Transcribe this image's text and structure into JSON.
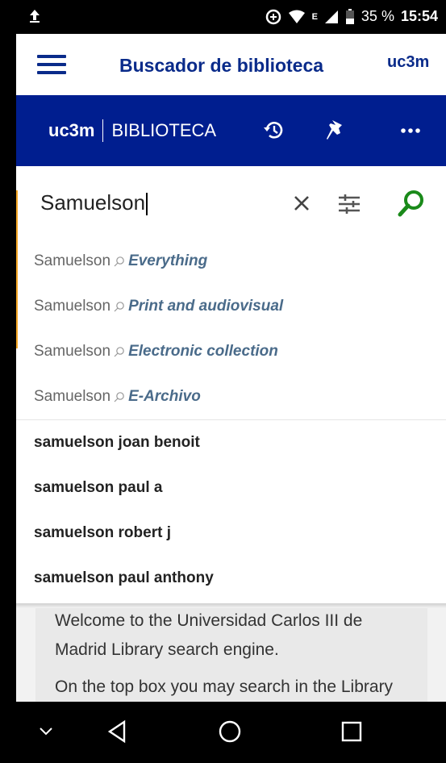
{
  "status": {
    "battery": "35 %",
    "time": "15:54",
    "network": "E"
  },
  "header": {
    "title": "Buscador de biblioteca",
    "logo": "uc3m",
    "menu_icon": "menu-icon"
  },
  "libbar": {
    "brand_uc3m": "uc3m",
    "brand_biblioteca": "BIBLIOTECA",
    "icons": [
      "history-icon",
      "pin-icon",
      "more-icon"
    ]
  },
  "search": {
    "value": "Samuelson"
  },
  "scopes": [
    {
      "term": "Samuelson",
      "scope": "Everything"
    },
    {
      "term": "Samuelson",
      "scope": "Print and audiovisual"
    },
    {
      "term": "Samuelson",
      "scope": "Electronic collection"
    },
    {
      "term": "Samuelson",
      "scope": "E-Archivo"
    }
  ],
  "suggestions": [
    "samuelson joan benoit",
    "samuelson paul a",
    "samuelson robert j",
    "samuelson paul anthony"
  ],
  "welcome": {
    "p1": "Welcome to the Universidad Carlos III de Madrid Library search engine.",
    "p2": "On the top box you may search in the Library information resources the"
  },
  "colors": {
    "brand_blue": "#001e8f",
    "title_blue": "#0a2b8a",
    "search_green": "#1a8a1a",
    "scope_text": "#4a6b8a"
  }
}
